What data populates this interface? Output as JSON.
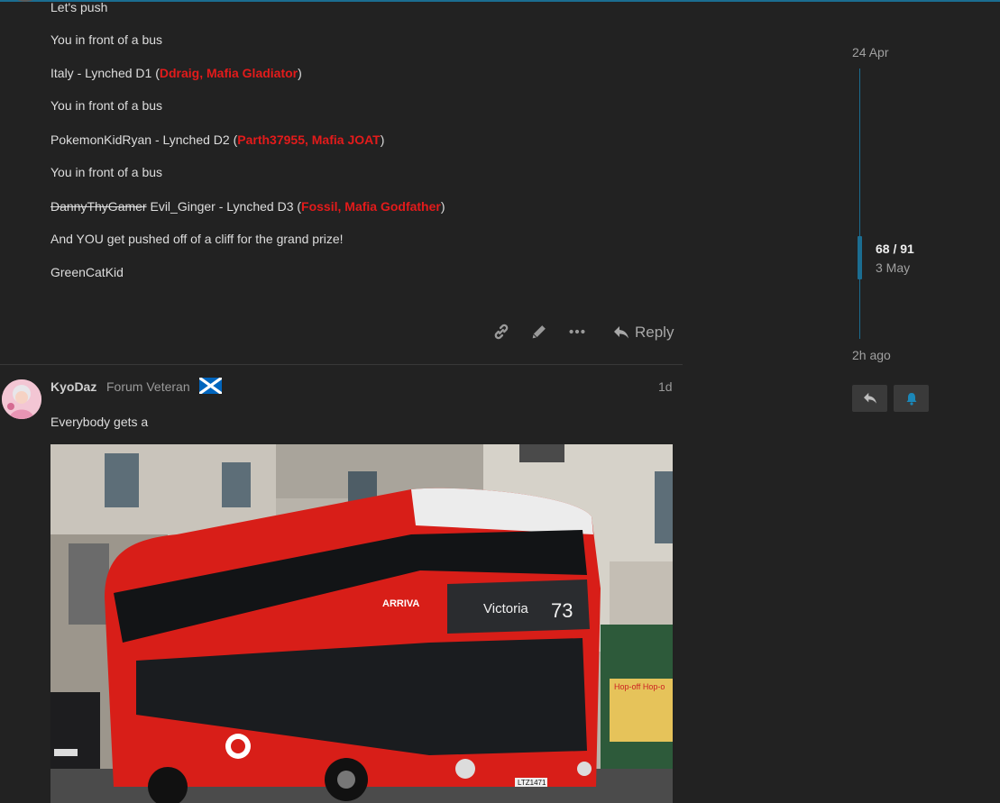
{
  "post1": {
    "lines": [
      {
        "text": "Let's push"
      },
      {
        "text": "You in front of a bus"
      },
      {
        "pre": "Italy - Lynched D1 (",
        "red": "Ddraig, Mafia Gladiator",
        "post": ")"
      },
      {
        "text": "You in front of a bus"
      },
      {
        "pre": "PokemonKidRyan - Lynched D2 (",
        "red": "Parth37955, Mafia JOAT",
        "post": ")"
      },
      {
        "text": "You in front of a bus"
      },
      {
        "strike": "DannyThyGamer",
        "pre": " Evil_Ginger - Lynched D3 (",
        "red": "Fossil, Mafia Godfather",
        "post": ")"
      },
      {
        "text": "And YOU get pushed off of a cliff for the grand prize!"
      },
      {
        "text": "GreenCatKid"
      }
    ],
    "actions": {
      "reply_label": "Reply"
    },
    "icons": [
      "link-icon",
      "pencil-icon",
      "more-icon",
      "reply-arrow-icon"
    ]
  },
  "post2": {
    "username": "KyoDaz",
    "user_title": "Forum Veteran",
    "age": "1d",
    "body": "Everybody gets a",
    "flag": "scotland-flag-icon",
    "image": {
      "bus_destination": "Victoria",
      "bus_route": "73",
      "operator": "ARRIVA",
      "plate": "LTZ1471",
      "kiosk_sign": "Hop-off Hop-o"
    }
  },
  "timeline": {
    "start_date": "24 Apr",
    "position": "68 / 91",
    "position_date": "3 May",
    "end_date": "2h ago",
    "progress_fraction": 0.71
  },
  "colors": {
    "background": "#222222",
    "accent": "#1b6d91",
    "mention_red": "#e31b1b",
    "text": "#dddddd",
    "muted": "#9a9a9a"
  }
}
